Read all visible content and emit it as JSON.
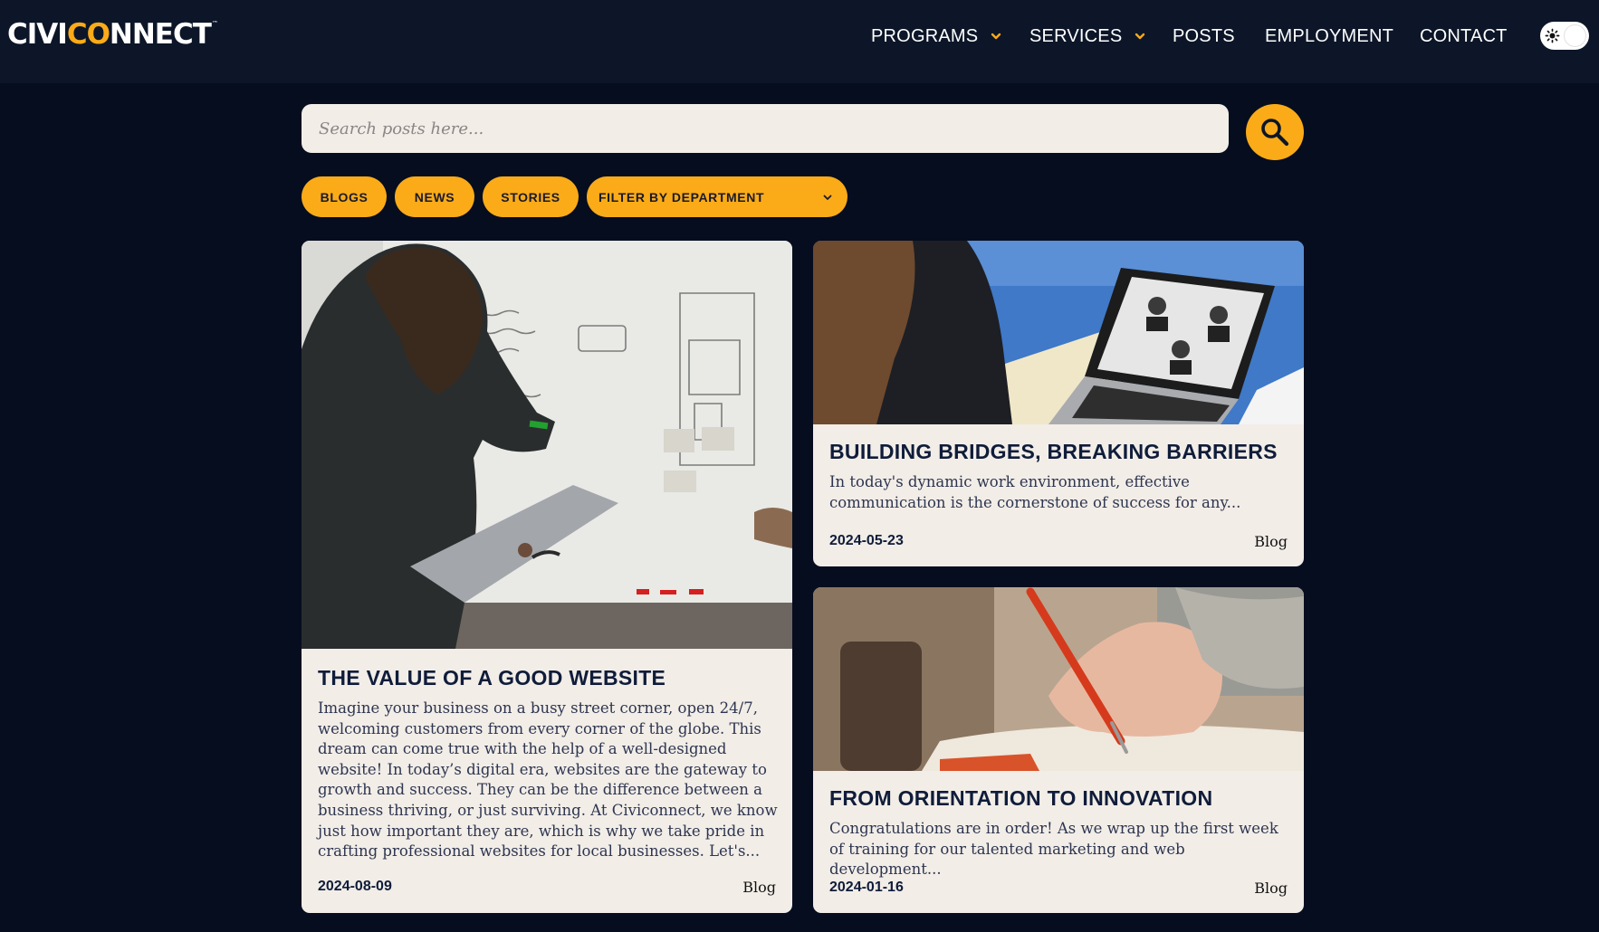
{
  "brand": {
    "logo_start": "CIVI",
    "logo_accent": "CO",
    "logo_end": "NNECT",
    "logo_tm": "™",
    "accent_color": "#fbab18",
    "navbar_color": "#0c1628",
    "page_bg_color": "#060d1f"
  },
  "nav": {
    "programs": "PROGRAMS",
    "services": "SERVICES",
    "posts": "POSTS",
    "employment": "EMPLOYMENT",
    "contact": "CONTACT"
  },
  "theme_toggle": {
    "icon": "sun-icon",
    "state": "light"
  },
  "search": {
    "placeholder": "Search posts here...",
    "value": ""
  },
  "filters": {
    "blogs": "BLOGS",
    "news": "NEWS",
    "stories": "STORIES",
    "department": "FILTER BY DEPARTMENT"
  },
  "posts": [
    {
      "title": "THE VALUE OF A GOOD WEBSITE",
      "excerpt": "Imagine your business on a busy street corner, open 24/7, welcoming customers from every corner of the globe. This dream can come true with the help of a well-designed website! In today’s digital era, websites are the gateway to growth and success. They can be the difference between a business thriving, or just surviving. At Civiconnect, we know just how important they are, which is why we take pride in crafting professional websites for local businesses. Let's...",
      "date": "2024-08-09",
      "type": "Blog"
    },
    {
      "title": "BUILDING BRIDGES, BREAKING BARRIERS",
      "excerpt": "In today's dynamic work environment, effective communication is the cornerstone of success for any...",
      "date": "2024-05-23",
      "type": "Blog"
    },
    {
      "title": "FROM ORIENTATION TO INNOVATION",
      "excerpt": "Congratulations are in order! As we wrap up the first week of training for our talented marketing and web development...",
      "date": "2024-01-16",
      "type": "Blog"
    }
  ]
}
